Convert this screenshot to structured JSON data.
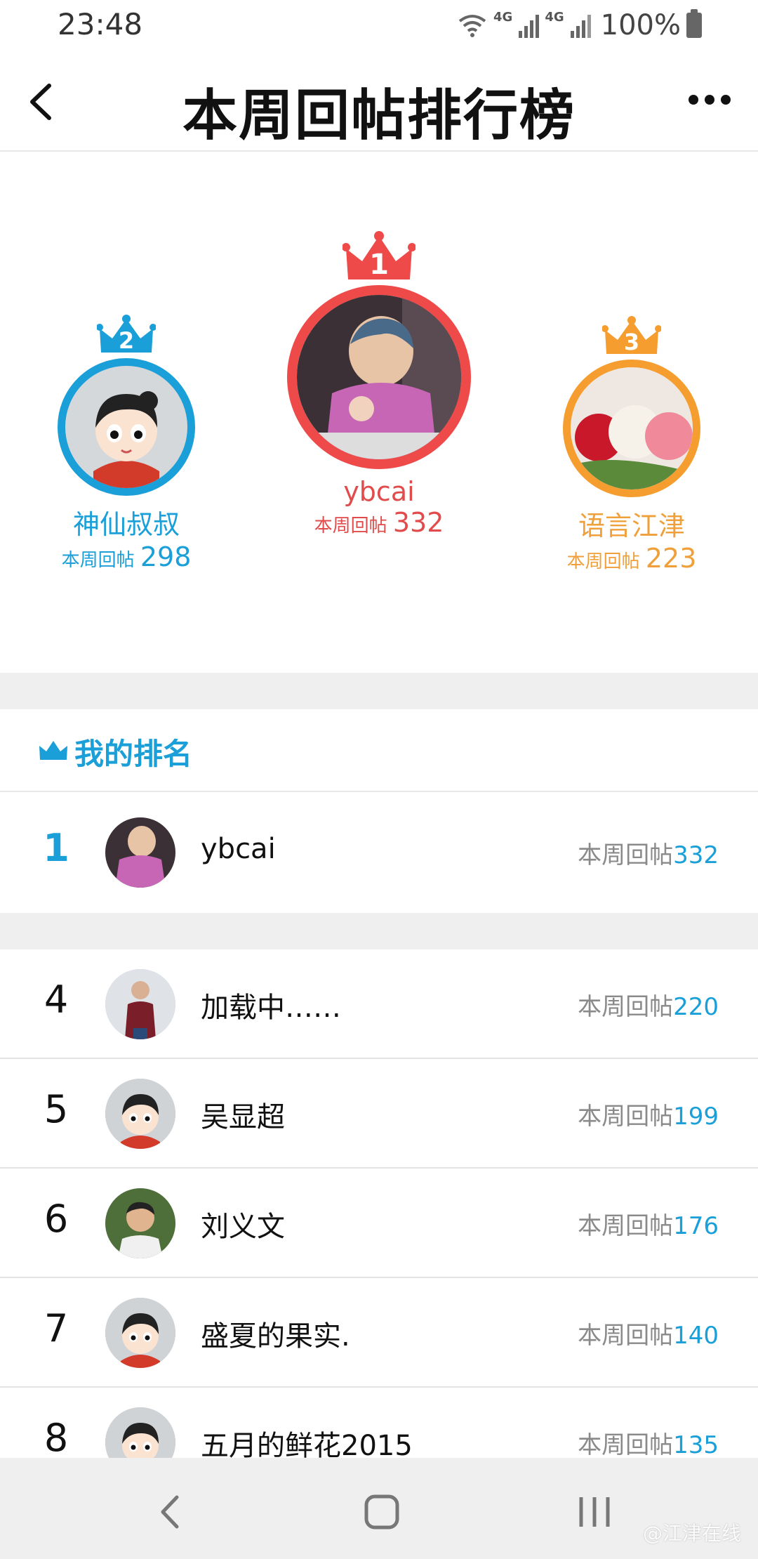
{
  "status_bar": {
    "time": "23:48",
    "network_1": "4G",
    "network_2": "4G",
    "battery_pct": "100%"
  },
  "header": {
    "title": "本周回帖排行榜"
  },
  "podium": {
    "first": {
      "rank": "1",
      "name": "ybcai",
      "label": "本周回帖",
      "count": "332"
    },
    "second": {
      "rank": "2",
      "name": "神仙叔叔",
      "label": "本周回帖",
      "count": "298"
    },
    "third": {
      "rank": "3",
      "name": "语言江津",
      "label": "本周回帖",
      "count": "223"
    }
  },
  "my_rank": {
    "title": "我的排名",
    "entry": {
      "rank": "1",
      "name": "ybcai",
      "label": "本周回帖",
      "count": "332"
    }
  },
  "ranking": [
    {
      "rank": "4",
      "name": "加载中……",
      "label": "本周回帖",
      "count": "220"
    },
    {
      "rank": "5",
      "name": "吴显超",
      "label": "本周回帖",
      "count": "199"
    },
    {
      "rank": "6",
      "name": "刘义文",
      "label": "本周回帖",
      "count": "176"
    },
    {
      "rank": "7",
      "name": "盛夏的果实.",
      "label": "本周回帖",
      "count": "140"
    },
    {
      "rank": "8",
      "name": "五月的鲜花2015",
      "label": "本周回帖",
      "count": "135"
    }
  ],
  "watermark": "@江津在线",
  "colors": {
    "accent_blue": "#1a9fd8",
    "first_red": "#ef4a4a",
    "third_orange": "#f59d2e"
  }
}
